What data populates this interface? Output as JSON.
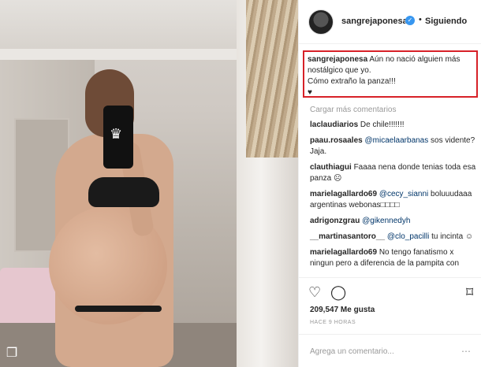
{
  "post": {
    "username": "sangrejaponesa",
    "follow_label": "Siguiendo",
    "dot": "•",
    "caption": {
      "username": "sangrejaponesa",
      "text_line1": "Aún no nació alguien más",
      "text_line2": "nostálgico que yo.",
      "text_line3": "Cómo extraño la panza!!!",
      "emoji": "♥"
    },
    "load_more": "Cargar más comentarios",
    "comments": [
      {
        "user": "laclaudiarios",
        "text": "De chile!!!!!!!"
      },
      {
        "user": "paau.rosaales",
        "mention": "@micaelaarbanas",
        "text": "sos vidente? Jaja."
      },
      {
        "user": "clauthiagui",
        "text": "Faaaa nena donde tenias toda esa panza ☹"
      },
      {
        "user": "marielagallardo69",
        "mention": "@cecy_sianni",
        "text": "boluuudaaa argentinas webonas□□□□"
      },
      {
        "user": "adrigonzgrau",
        "mention": "@gikennedyh",
        "text": ""
      },
      {
        "user": "__martinasantoro__",
        "mention": "@clo_pacilli",
        "text": "tu incinta ☺"
      },
      {
        "user": "marielagallardo69",
        "text": "No tengo fanatismo x ningun pero a diferencia de la pampita con"
      }
    ],
    "likes": "209,547 Me gusta",
    "time": "HACE 9 HORAS",
    "add_comment_placeholder": "Agrega un comentario...",
    "more_icon": "⋯"
  },
  "icons": {
    "like": "heart-icon",
    "comment": "comment-icon",
    "save": "bookmark-icon",
    "verified": "verified-badge-icon",
    "carousel": "carousel-icon"
  },
  "colors": {
    "highlight_border": "#d72128",
    "verified_blue": "#3897f0",
    "mention_blue": "#003569"
  }
}
